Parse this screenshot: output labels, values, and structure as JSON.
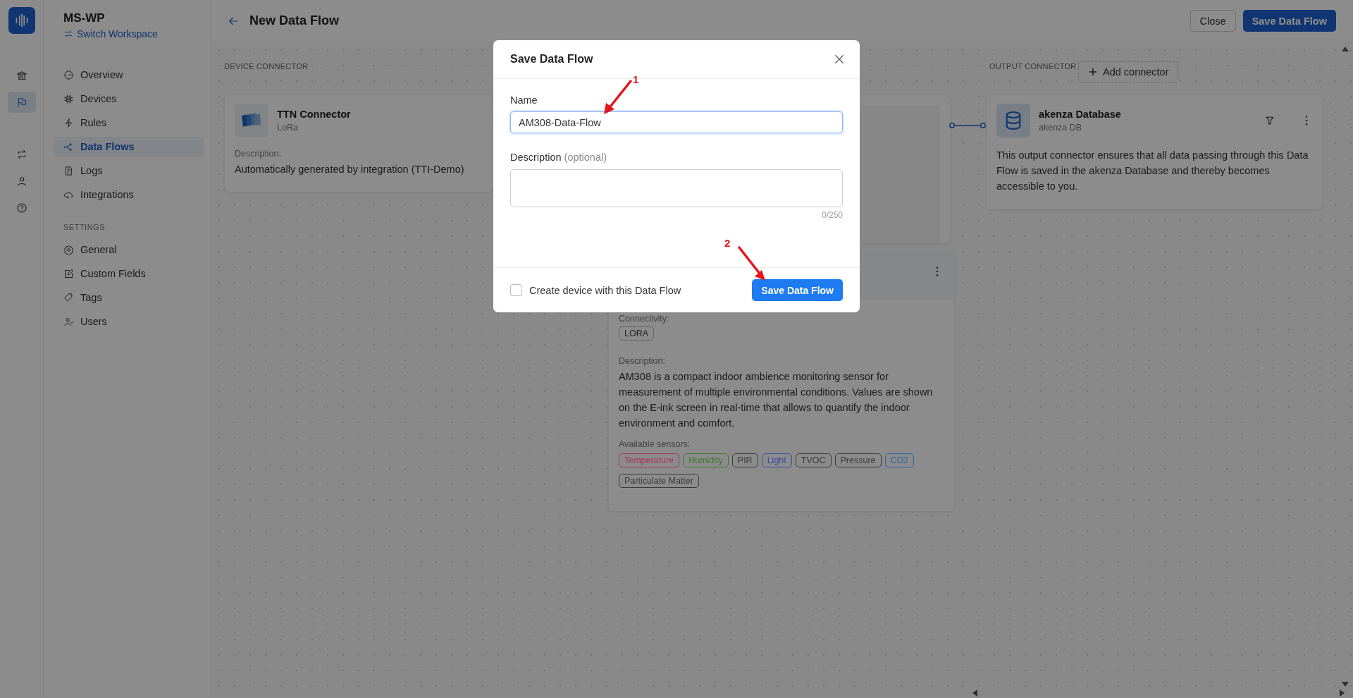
{
  "rail": {
    "items": [
      {
        "kind": "bank",
        "selected": false
      },
      {
        "kind": "flag",
        "selected": true
      },
      {
        "kind": "repeat",
        "selected": false
      },
      {
        "kind": "user",
        "selected": false
      },
      {
        "kind": "help",
        "selected": false
      }
    ]
  },
  "workspace": {
    "name": "MS-WP",
    "switch_label": "Switch Workspace"
  },
  "nav": {
    "items": [
      {
        "label": "Overview",
        "kind": "gauge",
        "selected": false
      },
      {
        "label": "Devices",
        "kind": "chip",
        "selected": false
      },
      {
        "label": "Rules",
        "kind": "bolt",
        "selected": false
      },
      {
        "label": "Data Flows",
        "kind": "share",
        "selected": true
      },
      {
        "label": "Logs",
        "kind": "log",
        "selected": false
      },
      {
        "label": "Integrations",
        "kind": "cloud",
        "selected": false
      }
    ],
    "settings_heading": "SETTINGS",
    "settings_items": [
      {
        "label": "General",
        "kind": "gear",
        "selected": false
      },
      {
        "label": "Custom Fields",
        "kind": "edit",
        "selected": false
      },
      {
        "label": "Tags",
        "kind": "tag",
        "selected": false
      },
      {
        "label": "Users",
        "kind": "users",
        "selected": false
      }
    ]
  },
  "header": {
    "title": "New Data Flow",
    "buttons": [
      {
        "label": "Close",
        "kind": "secondary"
      },
      {
        "label": "Save Data Flow",
        "kind": "primary"
      }
    ]
  },
  "canvas": {
    "device_connector": {
      "heading": "DEVICE CONNECTOR",
      "title": "TTN Connector",
      "subtitle": "LoRa",
      "description_label": "Description:",
      "description": "Automatically generated by integration (TTI-Demo)"
    },
    "device_type": {
      "connectivity_label": "Connectivity:",
      "connectivity": "LORA",
      "description_label": "Description:",
      "description": "AM308 is a compact indoor ambience monitoring sensor for measurement of multiple environmental conditions. Values are shown on the E-ink screen in real-time that allows to quantify the indoor environment and comfort.",
      "sensors_label": "Available sensors:",
      "sensors": [
        {
          "label": "Temperature",
          "color": "#a8345a"
        },
        {
          "label": "Humidity",
          "color": "#3a7a2a"
        },
        {
          "label": "PIR",
          "color": "#3a3a3a"
        },
        {
          "label": "Light",
          "color": "#3a4ea6"
        },
        {
          "label": "TVOC",
          "color": "#3a3a3a"
        },
        {
          "label": "Pressure",
          "color": "#3a3a3a"
        },
        {
          "label": "CO2",
          "color": "#2a66a8"
        },
        {
          "label": "Particulate Matter",
          "color": "#3a3a3a"
        }
      ]
    },
    "output_connector": {
      "heading": "OUTPUT CONNECTOR",
      "add_label": "Add connector",
      "title": "akenza Database",
      "subtitle": "akenza DB",
      "description": "This output connector ensures that all data passing through this Data Flow is saved in the akenza Database and thereby becomes accessible to you."
    }
  },
  "dialog": {
    "title": "Save Data Flow",
    "name_label": "Name",
    "name_value": "AM308-Data-Flow",
    "description_label": "Description",
    "optional_label": "(optional)",
    "counter": "0/250",
    "checkbox": {
      "label": "Create device with this Data Flow",
      "checked": false
    },
    "submit": "Save Data Flow"
  },
  "annotations": [
    {
      "label": "1"
    },
    {
      "label": "2"
    }
  ]
}
